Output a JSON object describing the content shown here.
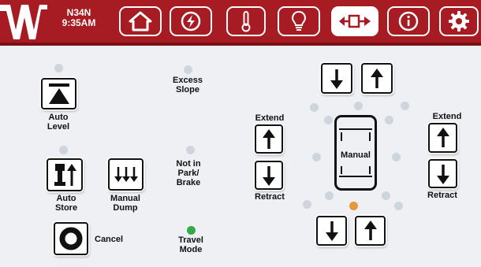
{
  "status": {
    "code": "N34N",
    "time": "9:35AM"
  },
  "nav": [
    {
      "id": "home",
      "icon": "home-icon",
      "active": false
    },
    {
      "id": "generator",
      "icon": "lightning-circle-icon",
      "active": false
    },
    {
      "id": "temperature",
      "icon": "thermometer-icon",
      "active": false
    },
    {
      "id": "lights",
      "icon": "lightbulb-icon",
      "active": false
    },
    {
      "id": "leveling",
      "icon": "slide-out-icon",
      "active": true
    },
    {
      "id": "info",
      "icon": "info-icon",
      "active": false
    },
    {
      "id": "settings",
      "icon": "gear-icon",
      "active": false
    }
  ],
  "controls": {
    "auto_level": "Auto\nLevel",
    "auto_store": "Auto\nStore",
    "manual_dump": "Manual\nDump",
    "cancel": "Cancel",
    "excess_slope": "Excess\nSlope",
    "not_in_park": "Not in\nPark/\nBrake",
    "travel_mode": "Travel\nMode",
    "extend_left": "Extend",
    "retract_left": "Retract",
    "extend_right": "Extend",
    "retract_right": "Retract",
    "manual": "Manual"
  },
  "indicators": {
    "travel_mode": "on",
    "front_jack": "on",
    "excess_slope": "off",
    "not_in_park": "off"
  },
  "colors": {
    "header": "#a61c22",
    "screen": "#eef0f3",
    "indicator_off": "#cfd5dd",
    "indicator_green": "#34a94a",
    "indicator_orange": "#e49a3a"
  }
}
